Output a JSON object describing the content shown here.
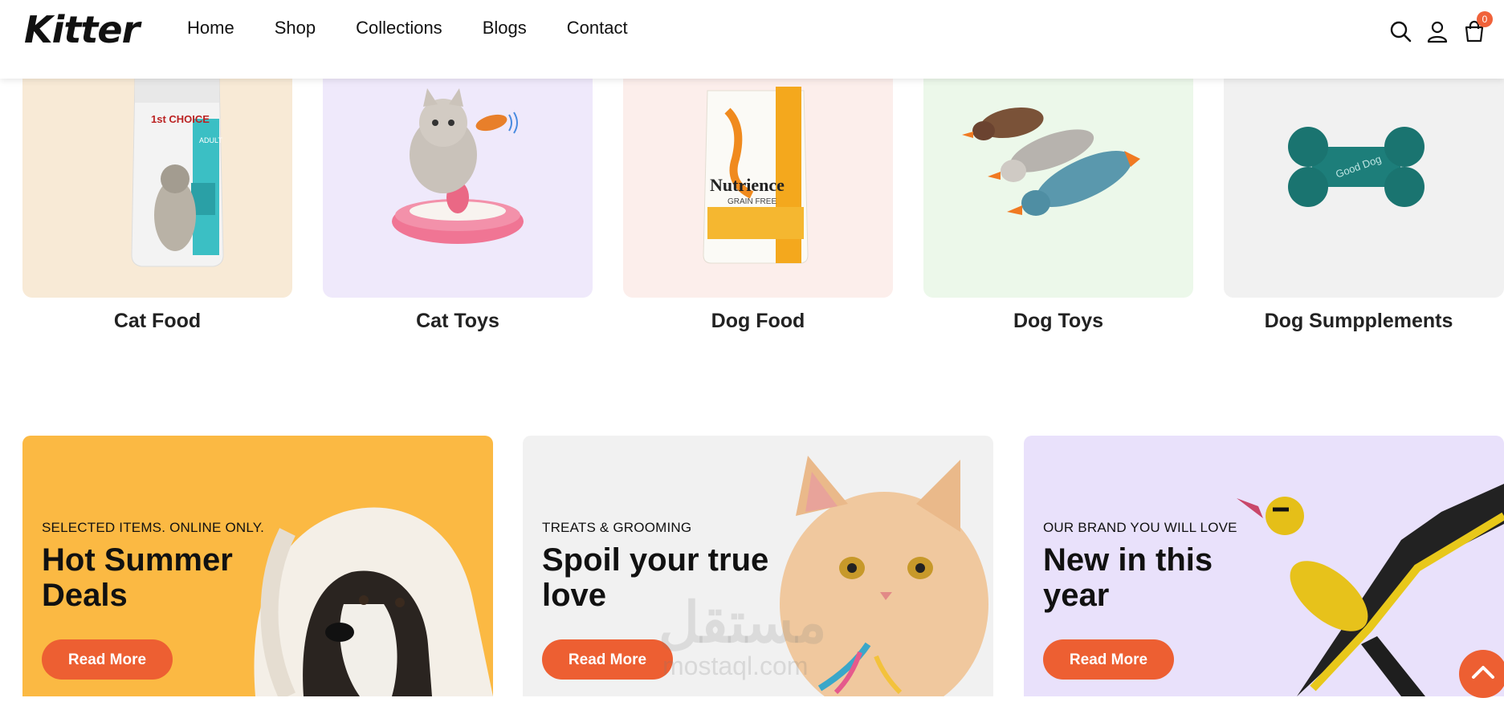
{
  "brand": {
    "logo": "Kitter"
  },
  "nav": {
    "items": [
      "Home",
      "Shop",
      "Collections",
      "Blogs",
      "Contact"
    ]
  },
  "header_icons": {
    "search": "search-icon",
    "account": "user-icon",
    "cart": "cart-icon",
    "cart_count": "0"
  },
  "categories": [
    {
      "label": "Cat Food",
      "bg": "#f8ead6",
      "pack_brand": "1st CHOICE",
      "pack_sub": "ADULT"
    },
    {
      "label": "Cat Toys",
      "bg": "#efe9fb"
    },
    {
      "label": "Dog Food",
      "bg": "#fceeeb",
      "pack_brand": "Nutrience",
      "pack_sub": "GRAIN FREE"
    },
    {
      "label": "Dog Toys",
      "bg": "#ecf8ea"
    },
    {
      "label": "Dog Sumpplements",
      "bg": "#f1f1f1",
      "toy_text": "Good Dog"
    }
  ],
  "promos": [
    {
      "eyebrow": "SELECTED ITEMS. ONLINE ONLY.",
      "title": "Hot Summer Deals",
      "button": "Read More",
      "bg": "#fbb943"
    },
    {
      "eyebrow": "TREATS & GROOMING",
      "title": "Spoil your true love",
      "button": "Read More",
      "bg": "#f1f1f1"
    },
    {
      "eyebrow": "OUR BRAND YOU WILL LOVE",
      "title": "New in this year",
      "button": "Read More",
      "bg": "#e9e1fb"
    }
  ],
  "colors": {
    "accent": "#ed5f32"
  },
  "watermark": {
    "arabic": "مستقل",
    "latin": "mostaql.com"
  }
}
